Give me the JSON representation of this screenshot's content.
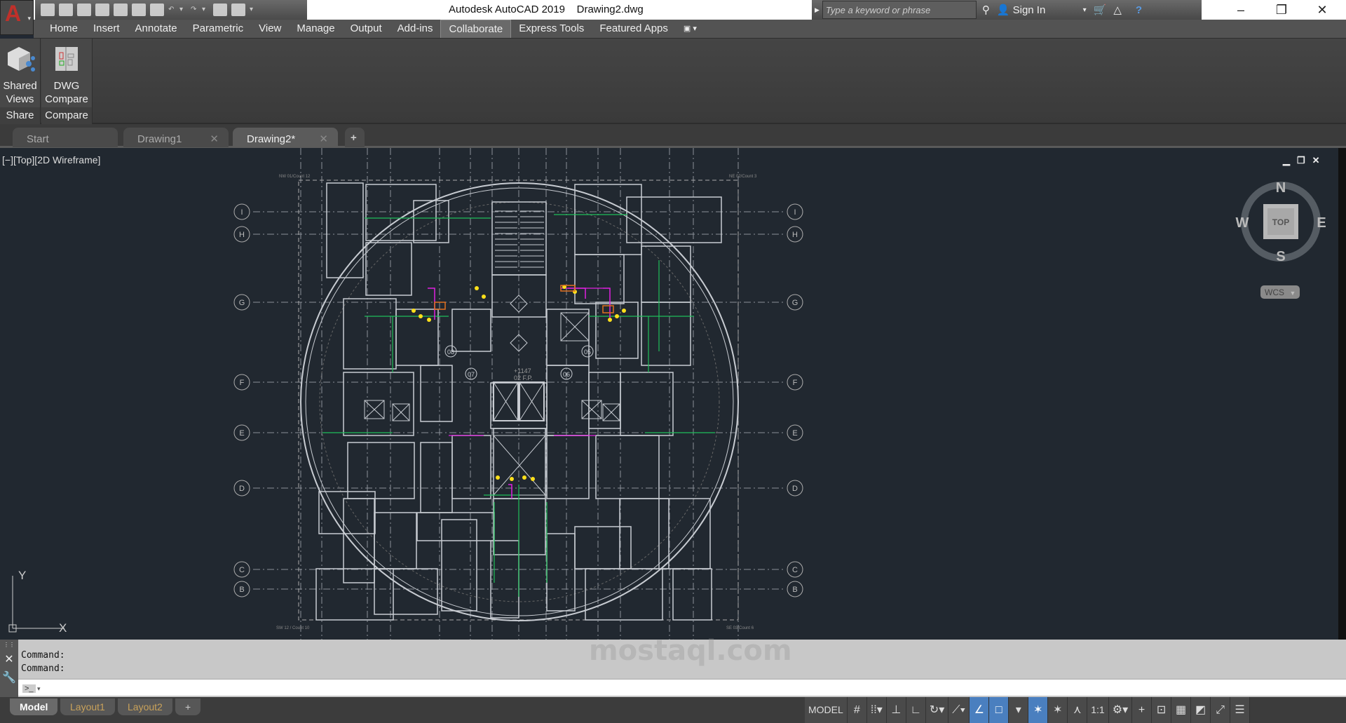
{
  "window": {
    "title": "Autodesk AutoCAD 2019    Drawing2.dwg",
    "minimize": "–",
    "restore": "❐",
    "close": "✕"
  },
  "app_menu": {
    "logo": "A"
  },
  "search": {
    "placeholder": "Type a keyword or phrase",
    "sign_in": "Sign In"
  },
  "ribbon_tabs": [
    "Home",
    "Insert",
    "Annotate",
    "Parametric",
    "View",
    "Manage",
    "Output",
    "Add-ins",
    "Collaborate",
    "Express Tools",
    "Featured Apps"
  ],
  "active_ribbon_tab": "Collaborate",
  "ribbon_panels": [
    {
      "button": "Shared\nViews",
      "label": "Share"
    },
    {
      "button": "DWG\nCompare",
      "label": "Compare"
    }
  ],
  "file_tabs": [
    {
      "label": "Start"
    },
    {
      "label": "Drawing1"
    },
    {
      "label": "Drawing2*"
    }
  ],
  "active_file_tab": "Drawing2*",
  "viewport": {
    "label": "[−][Top][2D Wireframe]"
  },
  "viewcube": {
    "n": "N",
    "s": "S",
    "e": "E",
    "w": "W",
    "face": "TOP",
    "ucs": "WCS"
  },
  "ucs_icon": {
    "x": "X",
    "y": "Y"
  },
  "drawing": {
    "grid_rows": [
      "I",
      "H",
      "G",
      "F",
      "E",
      "D",
      "C",
      "B"
    ],
    "room_tags": [
      "08",
      "07",
      "06",
      "05"
    ],
    "level_text": "+1147",
    "level_sub": "02 F.P.",
    "corners": [
      "NW 01/Count 12",
      "NE 02/Count 3",
      "SW 12 / Count 10",
      "SE 03/Count 6"
    ]
  },
  "command": {
    "history": [
      "Command:",
      "Command:"
    ],
    "prompt_icon": ">_"
  },
  "layout_tabs": [
    "Model",
    "Layout1",
    "Layout2"
  ],
  "active_layout": "Model",
  "status": {
    "model": "MODEL",
    "scale": "1:1"
  },
  "watermark": "mostaql.com",
  "colors": {
    "accent": "#4a7fbf",
    "drawing_lines": "#c8ccd2",
    "green": "#1fbf5a",
    "yellow": "#ffe01a",
    "magenta": "#e020e0",
    "orange": "#e07020"
  }
}
